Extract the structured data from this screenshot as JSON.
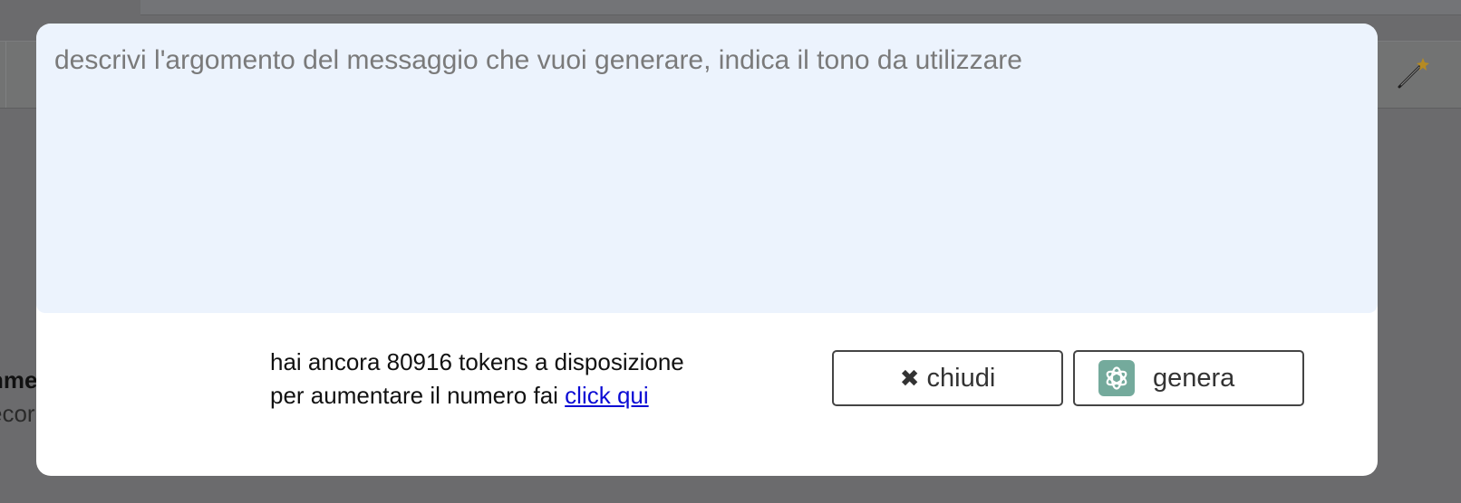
{
  "modal": {
    "prompt": {
      "placeholder": "descrivi l'argomento del messaggio che vuoi generare, indica il tono da utilizzare",
      "value": ""
    },
    "tokens": {
      "line1": "hai ancora 80916 tokens a disposizione",
      "line2_prefix": "per aumentare il numero fai ",
      "link_label": "click qui"
    },
    "buttons": {
      "close_label": "chiudi",
      "close_icon": "close-x-icon",
      "generate_label": "genera",
      "generate_icon": "openai-logo-icon"
    }
  },
  "background": {
    "side_text_bold": "nme",
    "side_text_light": "ecor",
    "toolbar_icon": "magic-wand-icon"
  },
  "colors": {
    "overlay": "#6b6b6d",
    "prompt_background": "#ecf3fd",
    "link": "#0b0bd4",
    "ai_icon_background": "#74aa9c"
  }
}
